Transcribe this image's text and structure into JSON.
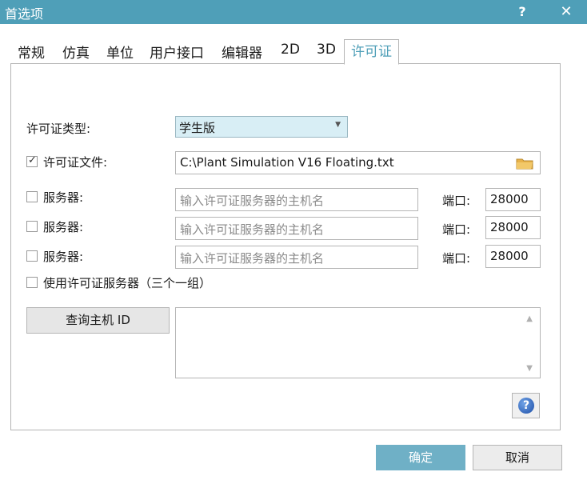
{
  "window": {
    "title": "首选项",
    "help": "?",
    "close": "✕"
  },
  "tabs": [
    {
      "label": "常规"
    },
    {
      "label": "仿真"
    },
    {
      "label": "单位"
    },
    {
      "label": "用户接口"
    },
    {
      "label": "编辑器"
    },
    {
      "label": "2D"
    },
    {
      "label": "3D"
    },
    {
      "label": "许可证",
      "active": true
    }
  ],
  "license": {
    "type_label": "许可证类型:",
    "type_value": "学生版",
    "file_label": "许可证文件:",
    "file_checked": true,
    "file_value": "C:\\Plant Simulation V16 Floating.txt",
    "servers": [
      {
        "label": "服务器:",
        "checked": false,
        "placeholder": "输入许可证服务器的主机名",
        "port_label": "端口:",
        "port": "28000"
      },
      {
        "label": "服务器:",
        "checked": false,
        "placeholder": "输入许可证服务器的主机名",
        "port_label": "端口:",
        "port": "28000"
      },
      {
        "label": "服务器:",
        "checked": false,
        "placeholder": "输入许可证服务器的主机名",
        "port_label": "端口:",
        "port": "28000"
      }
    ],
    "triad_label": "使用许可证服务器（三个一组）",
    "triad_checked": false,
    "query_button": "查询主机 ID",
    "host_id_text": ""
  },
  "footer": {
    "ok": "确定",
    "cancel": "取消"
  },
  "colors": {
    "accent": "#4f9fb8",
    "ok_button": "#6fb0c6",
    "combo_bg": "#d8eef5"
  }
}
